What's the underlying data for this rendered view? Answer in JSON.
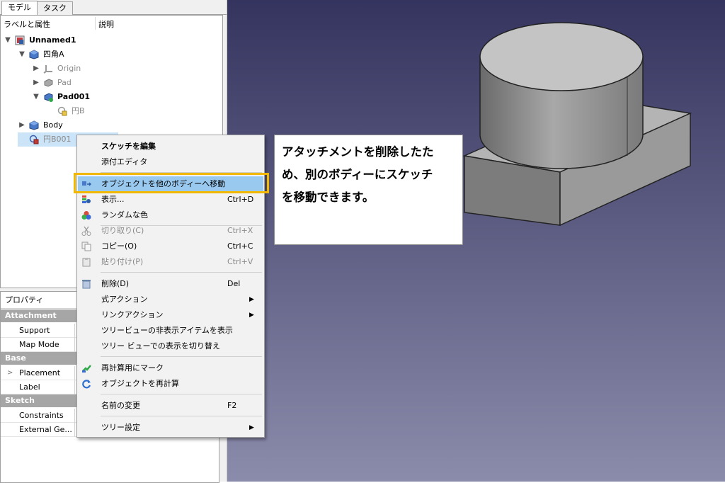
{
  "tabs": [
    "モデル",
    "タスク"
  ],
  "tree": {
    "header_label": "ラベルと属性",
    "header_desc": "説明",
    "nodes": [
      {
        "label": "Unnamed1"
      },
      {
        "label": "四角A"
      },
      {
        "label": "Origin"
      },
      {
        "label": "Pad"
      },
      {
        "label": "Pad001"
      },
      {
        "label": "円B"
      },
      {
        "label": "Body"
      },
      {
        "label": "円B001"
      }
    ]
  },
  "properties": {
    "header": "プロパティ",
    "groups": [
      "Attachment",
      "Base",
      "Sketch"
    ],
    "rows": [
      "Support",
      "Map Mode",
      "Placement",
      "Label",
      "Constraints",
      "External Ge..."
    ]
  },
  "context_menu": {
    "items": [
      {
        "label": "スケッチを編集",
        "shortcut": ""
      },
      {
        "label": "添付エディタ",
        "shortcut": ""
      },
      {
        "label": "オブジェクトを他のボディーへ移動",
        "shortcut": ""
      },
      {
        "label": "表示...",
        "shortcut": "Ctrl+D"
      },
      {
        "label": "ランダムな色",
        "shortcut": ""
      },
      {
        "label": "切り取り(C)",
        "shortcut": "Ctrl+X"
      },
      {
        "label": "コピー(O)",
        "shortcut": "Ctrl+C"
      },
      {
        "label": "貼り付け(P)",
        "shortcut": "Ctrl+V"
      },
      {
        "label": "削除(D)",
        "shortcut": "Del"
      },
      {
        "label": "式アクション",
        "shortcut": ""
      },
      {
        "label": "リンクアクション",
        "shortcut": ""
      },
      {
        "label": "ツリービューの非表示アイテムを表示",
        "shortcut": ""
      },
      {
        "label": "ツリー ビューでの表示を切り替え",
        "shortcut": ""
      },
      {
        "label": "再計算用にマーク",
        "shortcut": ""
      },
      {
        "label": "オブジェクトを再計算",
        "shortcut": ""
      },
      {
        "label": "名前の変更",
        "shortcut": "F2"
      },
      {
        "label": "ツリー設定",
        "shortcut": ""
      }
    ]
  },
  "callout": {
    "lines": [
      "アタッチメントを削除したた",
      "め、別のボディーにスケッチ",
      "を移動できます。"
    ]
  },
  "colors": {
    "highlight_frame": "#f2b800",
    "menu_selection": "#99c9ef",
    "viewport_top": "#34345f",
    "viewport_bottom": "#8b8bab"
  }
}
